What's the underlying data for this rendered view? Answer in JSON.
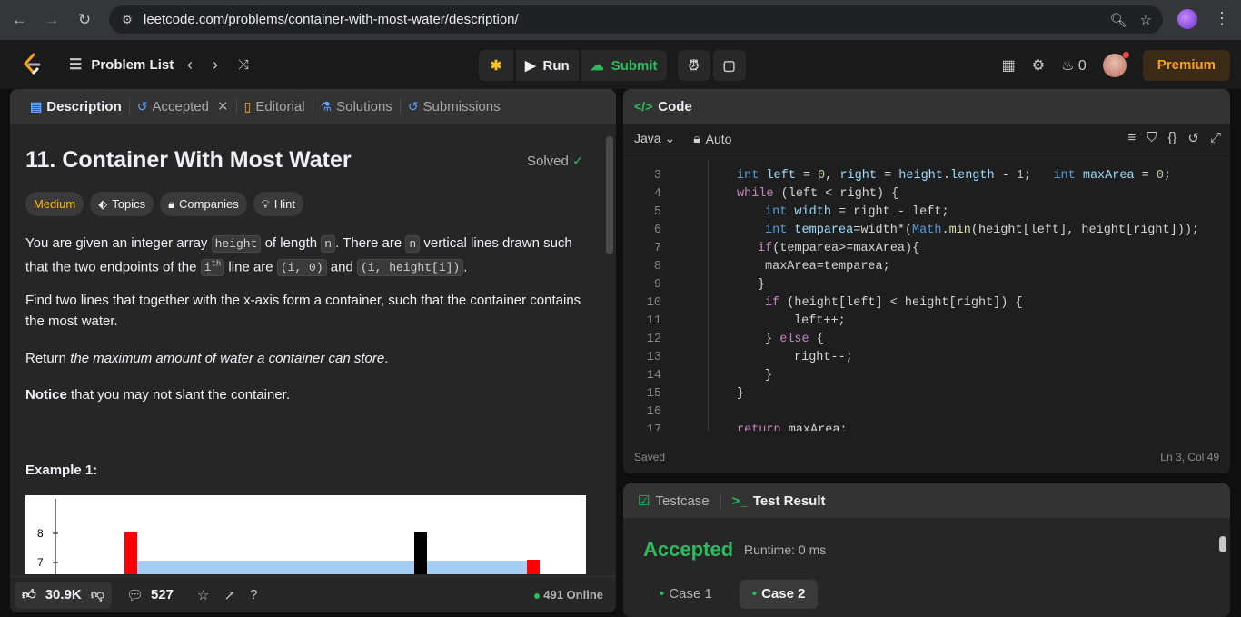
{
  "browser": {
    "url": "leetcode.com/problems/container-with-most-water/description/"
  },
  "nav": {
    "problem_list": "Problem List",
    "run": "Run",
    "submit": "Submit",
    "fire_count": "0",
    "premium": "Premium"
  },
  "left_tabs": [
    {
      "label": "Description"
    },
    {
      "label": "Accepted"
    },
    {
      "label": "Editorial"
    },
    {
      "label": "Solutions"
    },
    {
      "label": "Submissions"
    }
  ],
  "problem": {
    "title": "11. Container With Most Water",
    "status": "Solved",
    "tags": [
      "Medium",
      "Topics",
      "Companies",
      "Hint"
    ],
    "p1_a": "You are given an integer array ",
    "p1_code1": "height",
    "p1_b": " of length ",
    "p1_code2": "n",
    "p1_c": ". There are ",
    "p1_code3": "n",
    "p1_d": " vertical lines drawn such",
    "p1_e": "that the two endpoints of the ",
    "p1_code4": "i",
    "p1_sup": "th",
    "p1_f": " line are ",
    "p1_code5": "(i, 0)",
    "p1_g": " and ",
    "p1_code6": "(i, height[i])",
    "p1_h": ".",
    "p2": "Find two lines that together with the x-axis form a container, such that the container contains the most water.",
    "p3_a": "Return ",
    "p3_em": "the maximum amount of water a container can store",
    "p3_b": ".",
    "p4_strong": "Notice",
    "p4_rest": " that you may not slant the container.",
    "example": "Example 1:",
    "chart_ticks": [
      "8",
      "7"
    ]
  },
  "footer": {
    "likes": "30.9K",
    "comments": "527",
    "online": "491 Online"
  },
  "code": {
    "header": "Code",
    "language": "Java",
    "mode": "Auto",
    "status": "Saved",
    "cursor": "Ln 3, Col 49",
    "lines": [
      {
        "n": "3",
        "text": "int left = 0, right = height.length - 1;   int maxArea = 0;"
      },
      {
        "n": "4",
        "text": "while (left < right) {"
      },
      {
        "n": "5",
        "text": "    int width = right - left;"
      },
      {
        "n": "6",
        "text": "    int temparea=width*(Math.min(height[left], height[right]));"
      },
      {
        "n": "7",
        "text": "   if(temparea>=maxArea){"
      },
      {
        "n": "8",
        "text": "    maxArea=temparea;"
      },
      {
        "n": "9",
        "text": "   }"
      },
      {
        "n": "10",
        "text": "    if (height[left] < height[right]) {"
      },
      {
        "n": "11",
        "text": "        left++;"
      },
      {
        "n": "12",
        "text": "    } else {"
      },
      {
        "n": "13",
        "text": "        right--;"
      },
      {
        "n": "14",
        "text": "    }"
      },
      {
        "n": "15",
        "text": "}"
      },
      {
        "n": "16",
        "text": ""
      },
      {
        "n": "17",
        "text": "return maxArea;"
      }
    ]
  },
  "result": {
    "tab_testcase": "Testcase",
    "tab_result": "Test Result",
    "verdict": "Accepted",
    "runtime": "Runtime: 0 ms",
    "cases": [
      "Case 1",
      "Case 2"
    ]
  }
}
